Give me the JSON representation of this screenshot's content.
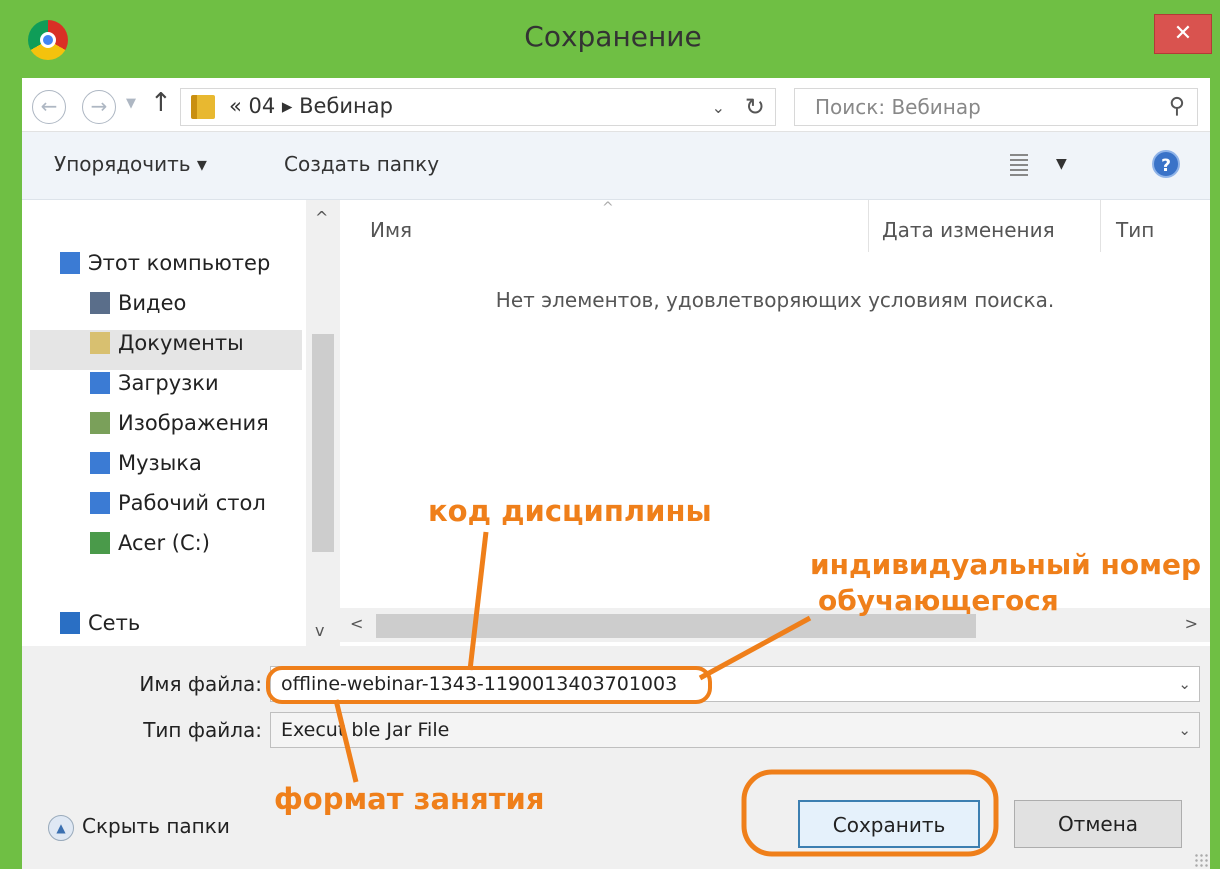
{
  "window": {
    "title": "Сохранение",
    "close_glyph": "✕"
  },
  "address": {
    "path": "« 04 ▸ Вебинар",
    "search_placeholder": "Поиск: Вебинар"
  },
  "toolbar": {
    "organize_label": "Упорядочить ▾",
    "new_folder_label": "Создать папку"
  },
  "nav": {
    "items": [
      {
        "label": "Этот компьютер",
        "icon": "computer-icon",
        "color": "#3b7bd4"
      },
      {
        "label": "Видео",
        "icon": "video-folder-icon",
        "color": "#5a6e8a"
      },
      {
        "label": "Документы",
        "icon": "documents-folder-icon",
        "color": "#d8c070",
        "selected": true
      },
      {
        "label": "Загрузки",
        "icon": "downloads-folder-icon",
        "color": "#3b7bd4"
      },
      {
        "label": "Изображения",
        "icon": "pictures-folder-icon",
        "color": "#7aa05a"
      },
      {
        "label": "Музыка",
        "icon": "music-folder-icon",
        "color": "#3b7bd4"
      },
      {
        "label": "Рабочий стол",
        "icon": "desktop-folder-icon",
        "color": "#3b7bd4"
      },
      {
        "label": "Acer (C:)",
        "icon": "drive-icon",
        "color": "#4a9a4a"
      },
      {
        "label": "Сеть",
        "icon": "network-icon",
        "color": "#2a6fc4"
      }
    ]
  },
  "files": {
    "columns": [
      "Имя",
      "Дата изменения",
      "Тип"
    ],
    "empty_message": "Нет элементов, удовлетворяющих условиям поиска."
  },
  "form": {
    "filename_label": "Имя файла:",
    "filename_value": "offline-webinar-1343-1190013403701003",
    "filetype_label": "Тип файла:",
    "filetype_value": "Execut ble Jar File"
  },
  "footer": {
    "hide_folders_label": "Скрыть папки",
    "save_label": "Сохранить",
    "cancel_label": "Отмена"
  },
  "annotations": {
    "discipline_code": "код дисциплины",
    "student_number_line1": "индивидуальный номер",
    "student_number_line2": "обучающегося",
    "lesson_format": "формат занятия",
    "color": "#ef7f1a"
  }
}
